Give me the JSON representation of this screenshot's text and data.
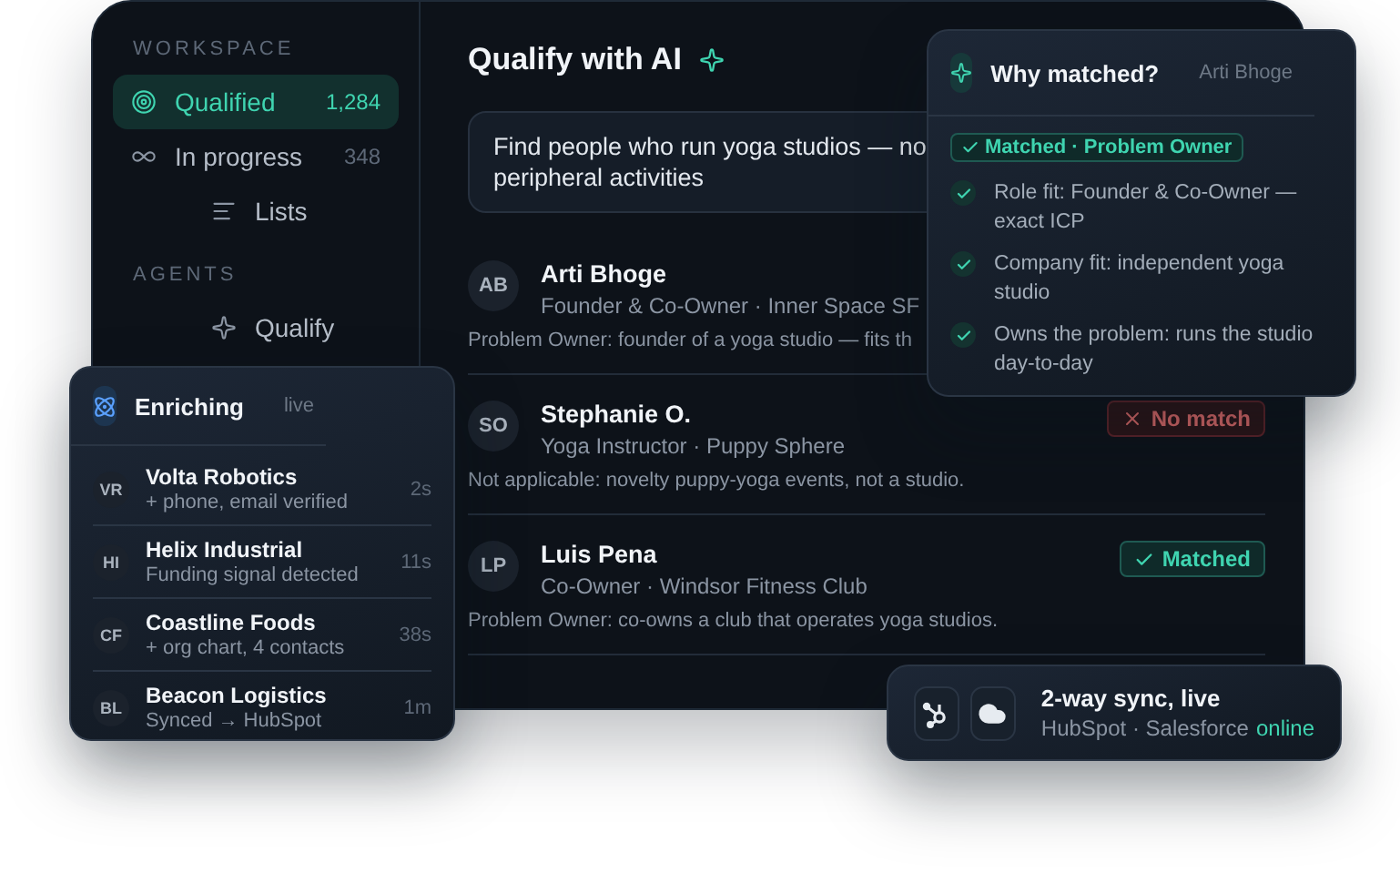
{
  "sidebar": {
    "sections": [
      {
        "heading": "WORKSPACE",
        "items": [
          {
            "label": "Qualified",
            "count": "1,284",
            "selected": true
          },
          {
            "label": "In progress",
            "count": "348",
            "selected": false
          },
          {
            "label": "Lists",
            "selected": false
          }
        ]
      },
      {
        "heading": "AGENTS",
        "items": [
          {
            "label": "Qualify",
            "selected": false
          }
        ]
      }
    ]
  },
  "main": {
    "title": "Qualify with AI",
    "prompt": "Find people who run yoga studios — no\nperipheral activities",
    "results": [
      {
        "initials": "AB",
        "name": "Arti Bhoge",
        "subtitle": "Founder & Co-Owner · Inner Space SF",
        "note": "Problem Owner: founder of a yoga studio — fits th"
      },
      {
        "initials": "SO",
        "name": "Stephanie O.",
        "subtitle": "Yoga Instructor · Puppy Sphere",
        "note": "Not applicable: novelty puppy-yoga events, not a studio.",
        "kind": "rejected",
        "badge": "No match"
      },
      {
        "initials": "LP",
        "name": "Luis Pena",
        "subtitle": "Co-Owner · Windsor Fitness Club",
        "note": "Problem Owner: co-owns a club that operates yoga studios.",
        "kind": "matched",
        "badge": "Matched"
      }
    ]
  },
  "why_matched": {
    "title": "Why matched?",
    "person": "Arti Bhoge",
    "tag": "Matched · Problem Owner",
    "reasons": [
      "Role fit: Founder & Co-Owner — exact ICP",
      "Company fit: independent yoga studio",
      "Owns the problem: runs the studio day-to-day"
    ]
  },
  "enriching": {
    "title": "Enriching",
    "status": "live",
    "items": [
      {
        "initials": "VR",
        "name": "Volta Robotics",
        "detail": "+ phone, email verified",
        "time": "2s"
      },
      {
        "initials": "HI",
        "name": "Helix Industrial",
        "detail": "Funding signal detected",
        "time": "11s"
      },
      {
        "initials": "CF",
        "name": "Coastline Foods",
        "detail": "+ org chart, 4 contacts",
        "time": "38s"
      },
      {
        "initials": "BL",
        "name": "Beacon Logistics",
        "detail": "Synced → HubSpot",
        "time": "1m"
      }
    ]
  },
  "sync": {
    "title": "2-way sync, live",
    "services": "HubSpot · Salesforce",
    "status": "online"
  }
}
